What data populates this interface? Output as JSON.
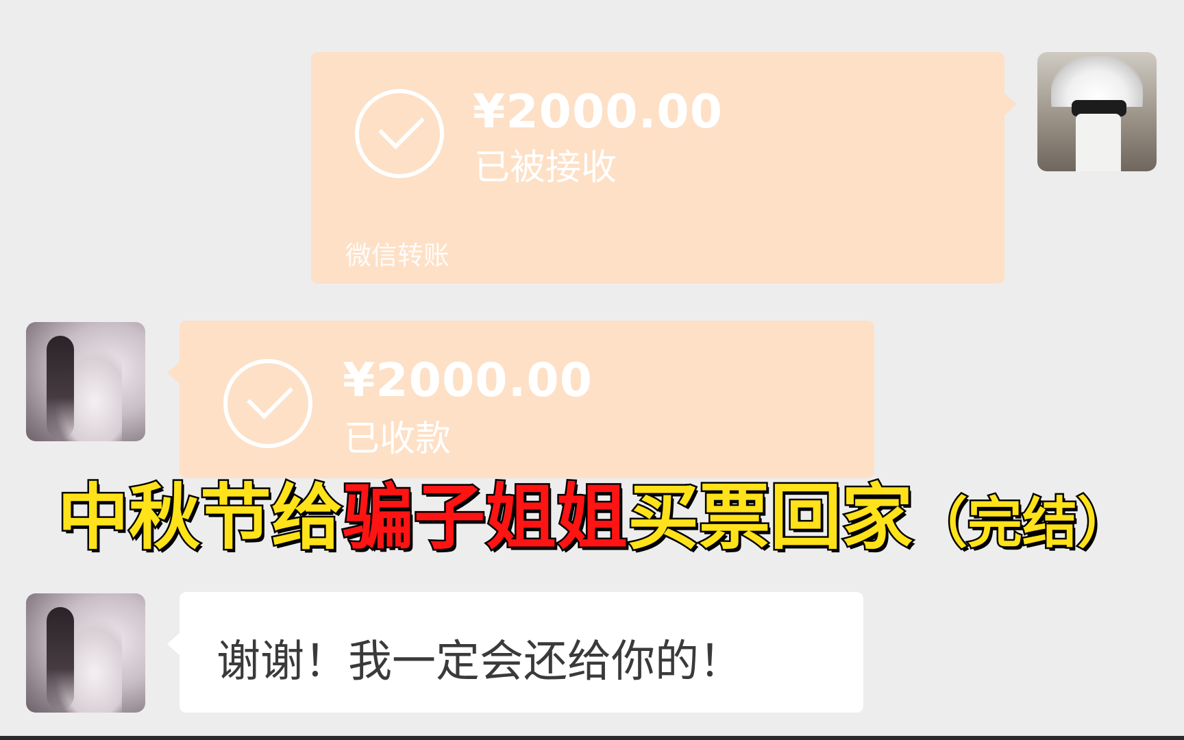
{
  "messages": [
    {
      "type": "transfer",
      "sender": "self",
      "amount": "¥2000.00",
      "status": "已被接收",
      "source": "微信转账"
    },
    {
      "type": "transfer",
      "sender": "other",
      "amount": "¥2000.00",
      "status": "已收款"
    },
    {
      "type": "text",
      "sender": "other",
      "text": "谢谢！我一定会还给你的！"
    }
  ],
  "overlay_title": {
    "part1": "中秋节给",
    "part2": "骗子姐姐",
    "part3": "买票回家",
    "part4": "（完结）"
  },
  "colors": {
    "transfer_bubble": "#fde0c6",
    "title_yellow": "#ffe21a",
    "title_red": "#ff1414",
    "background": "#ededed"
  }
}
